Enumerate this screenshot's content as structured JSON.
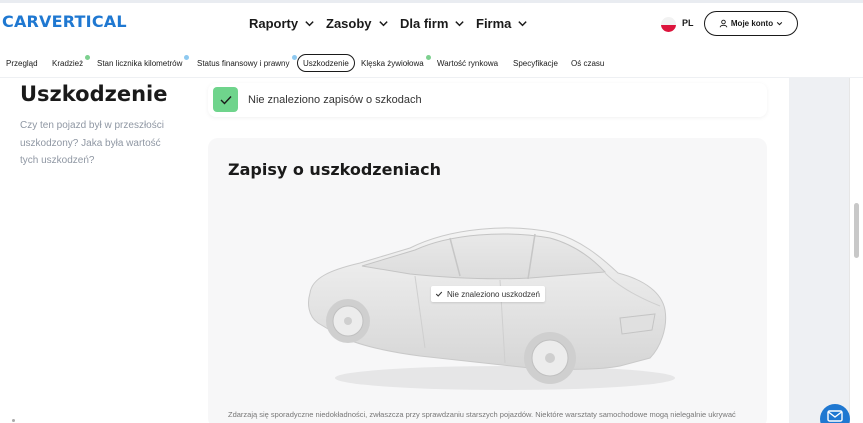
{
  "header": {
    "logo": "CARVERTICAL",
    "nav": [
      {
        "label": "Raporty"
      },
      {
        "label": "Zasoby"
      },
      {
        "label": "Dla firm"
      },
      {
        "label": "Firma"
      }
    ],
    "language": "PL",
    "account_label": "Moje konto"
  },
  "tabs": [
    {
      "label": "Przegląd",
      "dot": ""
    },
    {
      "label": "Kradzież",
      "dot": "#7dd08f"
    },
    {
      "label": "Stan licznika kilometrów",
      "dot": "#8ec9f0"
    },
    {
      "label": "Status finansowy i prawny",
      "dot": "#8ec9f0"
    },
    {
      "label": "Uszkodzenie",
      "dot": "",
      "active": true
    },
    {
      "label": "Klęska żywiołowa",
      "dot": "#7dd08f"
    },
    {
      "label": "Wartość rynkowa",
      "dot": ""
    },
    {
      "label": "Specyfikacje",
      "dot": ""
    },
    {
      "label": "Oś czasu",
      "dot": ""
    }
  ],
  "section": {
    "title": "Uszkodzenie",
    "subtitle": "Czy ten pojazd był w przeszłości uszkodzony? Jaka była wartość tych uszkodzeń?"
  },
  "notice": {
    "text": "Nie znaleziono zapisów o szkodach",
    "status_color": "#6fd48c"
  },
  "damage_card": {
    "title": "Zapisy o uszkodzeniach",
    "car_tag": "Nie znaleziono uszkodzeń",
    "description": "Zdarzają się sporadyczne niedokładności, zwłaszcza przy sprawdzaniu starszych pojazdów. Niektóre warsztaty samochodowe mogą nielegalnie ukrywać"
  },
  "colors": {
    "brand": "#1f78d1",
    "text": "#1a1a1a",
    "muted": "#8f97a3"
  },
  "icons": {
    "account": "user-icon",
    "chat": "mail-icon",
    "check": "check-icon"
  }
}
